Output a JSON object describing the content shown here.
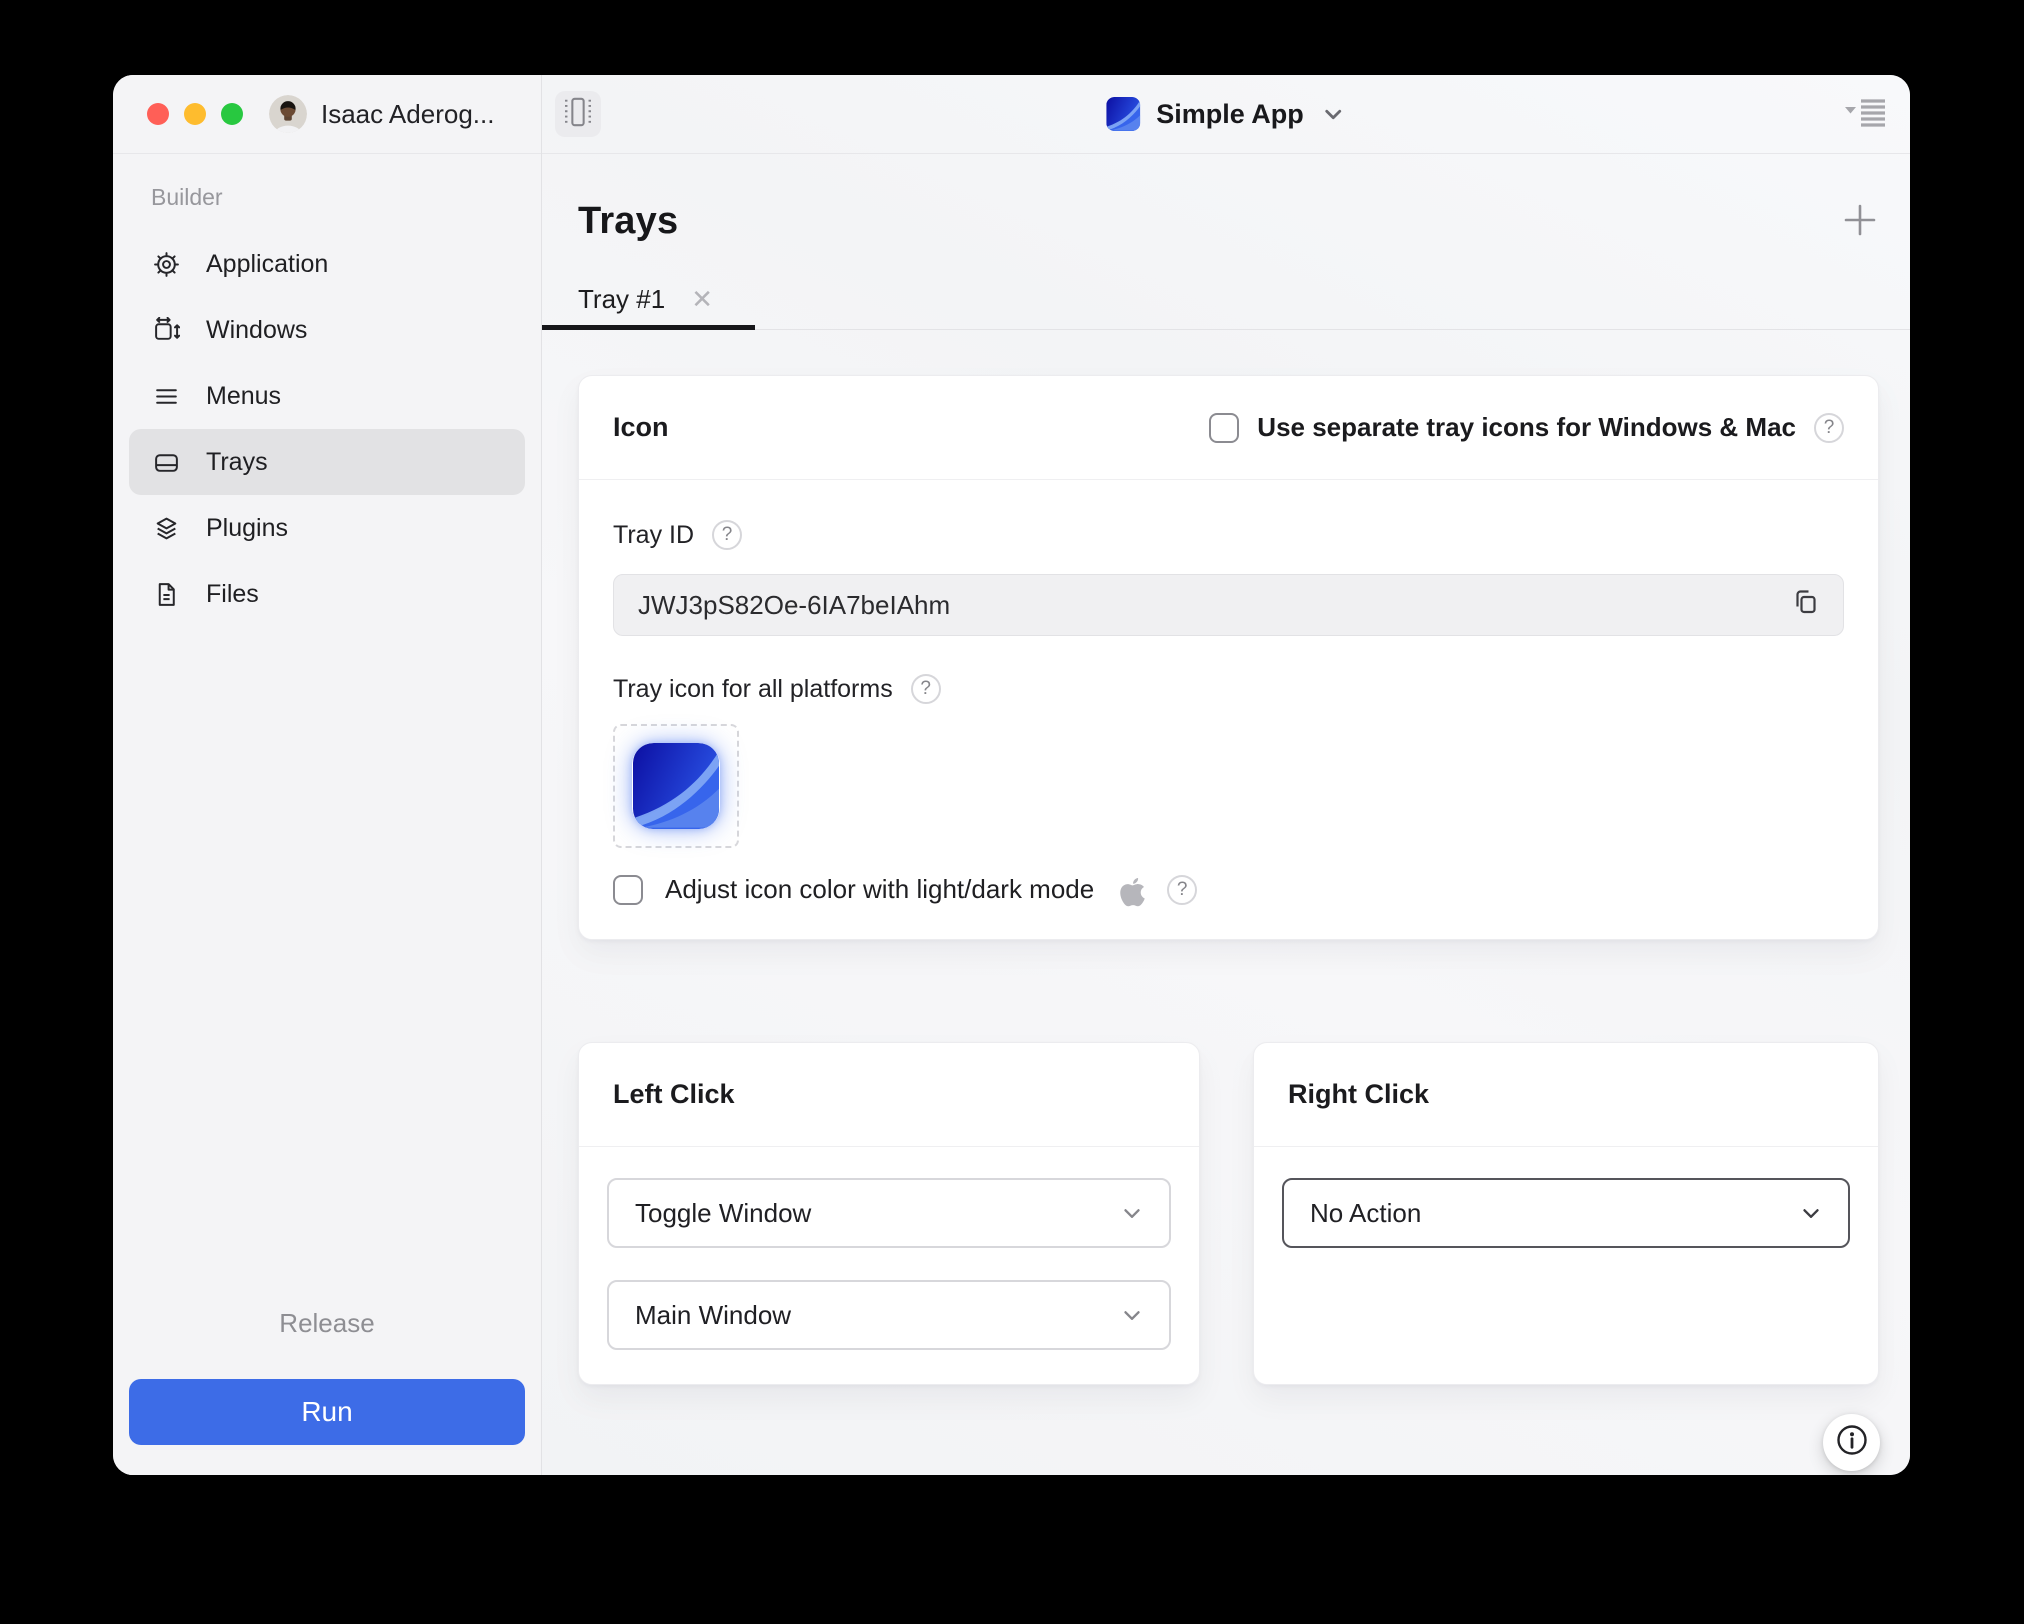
{
  "titlebar": {
    "user_name": "Isaac Aderog...",
    "app_name": "Simple App"
  },
  "sidebar": {
    "section_label": "Builder",
    "items": [
      {
        "label": "Application",
        "icon": "gear-icon"
      },
      {
        "label": "Windows",
        "icon": "window-resize-icon"
      },
      {
        "label": "Menus",
        "icon": "menu-lines-icon"
      },
      {
        "label": "Trays",
        "icon": "tray-icon",
        "selected": true
      },
      {
        "label": "Plugins",
        "icon": "layers-icon"
      },
      {
        "label": "Files",
        "icon": "document-icon"
      }
    ],
    "release_label": "Release",
    "run_label": "Run"
  },
  "content": {
    "page_title": "Trays",
    "tab": {
      "label": "Tray #1"
    },
    "icon_card": {
      "title": "Icon",
      "separate_icons": {
        "label": "Use separate tray icons for Windows & Mac",
        "checked": false
      },
      "tray_id": {
        "label": "Tray ID",
        "value": "JWJ3pS82Oe-6IA7beIAhm"
      },
      "tray_icon_label": "Tray icon for all platforms",
      "adjust_color": {
        "label": "Adjust icon color with light/dark mode",
        "checked": false
      }
    },
    "left_click_card": {
      "title": "Left Click",
      "action_value": "Toggle Window",
      "window_value": "Main Window"
    },
    "right_click_card": {
      "title": "Right Click",
      "action_value": "No Action"
    }
  },
  "glyphs": {
    "close": "✕",
    "help": "?"
  },
  "colors": {
    "accent_blue": "#3d6ce7",
    "icon_navy": "#0d11a4",
    "icon_blue": "#2b55e6",
    "icon_light_blue": "#7fa6f4",
    "traffic_red": "#ff5f57",
    "traffic_yellow": "#febc2e",
    "traffic_green": "#28c840"
  }
}
